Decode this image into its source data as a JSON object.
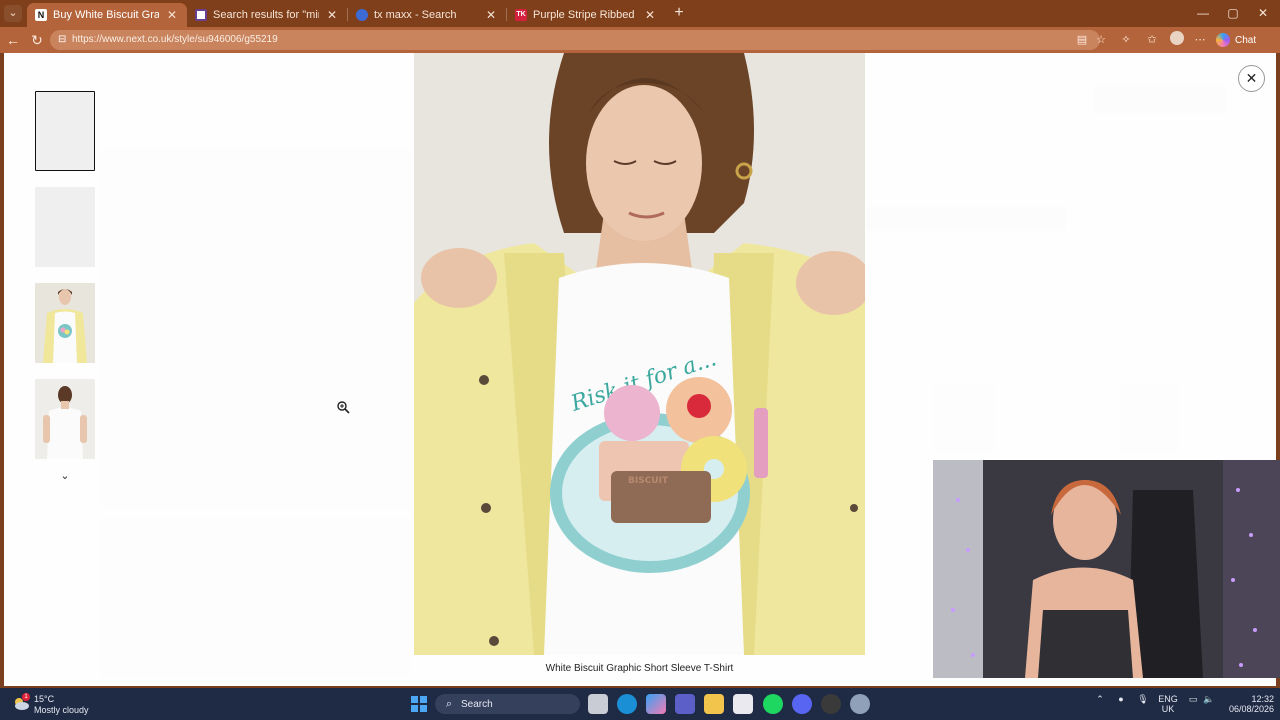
{
  "browser": {
    "tabs": [
      {
        "title": "Buy White Biscuit Graphic Short Sl",
        "favicon": "N",
        "favicon_color": "#ffffff",
        "active": true
      },
      {
        "title": "Search results for \"mini dress\"",
        "favicon": "",
        "favicon_color": "#ffffff",
        "active": false
      },
      {
        "title": "tx maxx - Search",
        "favicon": "",
        "favicon_color": "#3c6bd6",
        "active": false
      },
      {
        "title": "Purple Stripe Ribbed Cancun Bral",
        "favicon": "TK",
        "favicon_color": "#d4213d",
        "active": false
      }
    ],
    "new_tab": "+",
    "url": "https://www.next.co.uk/style/su946006/g55219",
    "chat_label": "Chat",
    "window_controls": {
      "minimize": "—",
      "maximize": "▢",
      "close": "✕"
    }
  },
  "lightbox": {
    "caption": "White Biscuit Graphic Short Sleeve T-Shirt",
    "close_symbol": "✕",
    "thumbnail_count": 4,
    "selected_thumbnail": 1,
    "scroll_down": "⌄"
  },
  "print_text": "Risk it for a...",
  "biscuit_label": "BISCUIT",
  "taskbar": {
    "weather": {
      "temp": "15°C",
      "desc": "Mostly cloudy",
      "badge": "1"
    },
    "search_placeholder": "Search",
    "lang": "ENG",
    "region": "UK",
    "time": "12:32",
    "date": "06/08/2026"
  },
  "colors": {
    "tabstrip": "#7f3f1b",
    "active_tab": "#b4643a",
    "taskbar": "#1f2a44"
  }
}
